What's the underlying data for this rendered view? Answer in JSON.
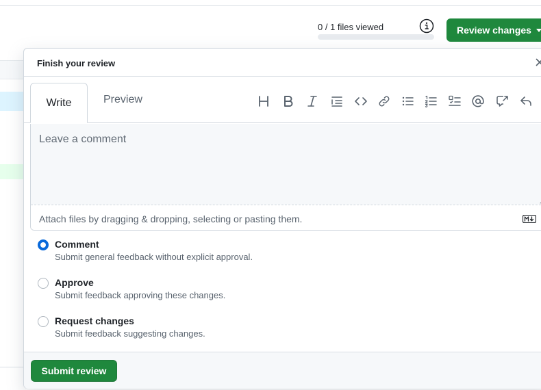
{
  "header": {
    "files_viewed": "0 / 1 files viewed",
    "files_viewed_progress": 0,
    "info_icon": "info-icon",
    "review_button_label": "Review changes"
  },
  "popover": {
    "title": "Finish your review",
    "close_icon": "close-icon",
    "tabs": [
      {
        "label": "Write",
        "active": true
      },
      {
        "label": "Preview",
        "active": false
      }
    ],
    "toolbar_icons": [
      "heading-icon",
      "bold-icon",
      "italic-icon",
      "quote-icon",
      "code-icon",
      "link-icon",
      "unordered-list-icon",
      "ordered-list-icon",
      "task-list-icon",
      "mention-icon",
      "cross-reference-icon",
      "saved-replies-icon"
    ],
    "comment": {
      "placeholder": "Leave a comment",
      "value": ""
    },
    "attach_text": "Attach files by dragging & dropping, selecting or pasting them.",
    "markdown_icon": "markdown-icon",
    "options": [
      {
        "label": "Comment",
        "description": "Submit general feedback without explicit approval.",
        "checked": true
      },
      {
        "label": "Approve",
        "description": "Submit feedback approving these changes.",
        "checked": false
      },
      {
        "label": "Request changes",
        "description": "Submit feedback suggesting changes.",
        "checked": false
      }
    ],
    "submit_label": "Submit review"
  },
  "colors": {
    "primary_green": "#1f883d",
    "radio_blue": "#0969da",
    "muted_text": "#59636e",
    "border": "#d0d7de"
  }
}
